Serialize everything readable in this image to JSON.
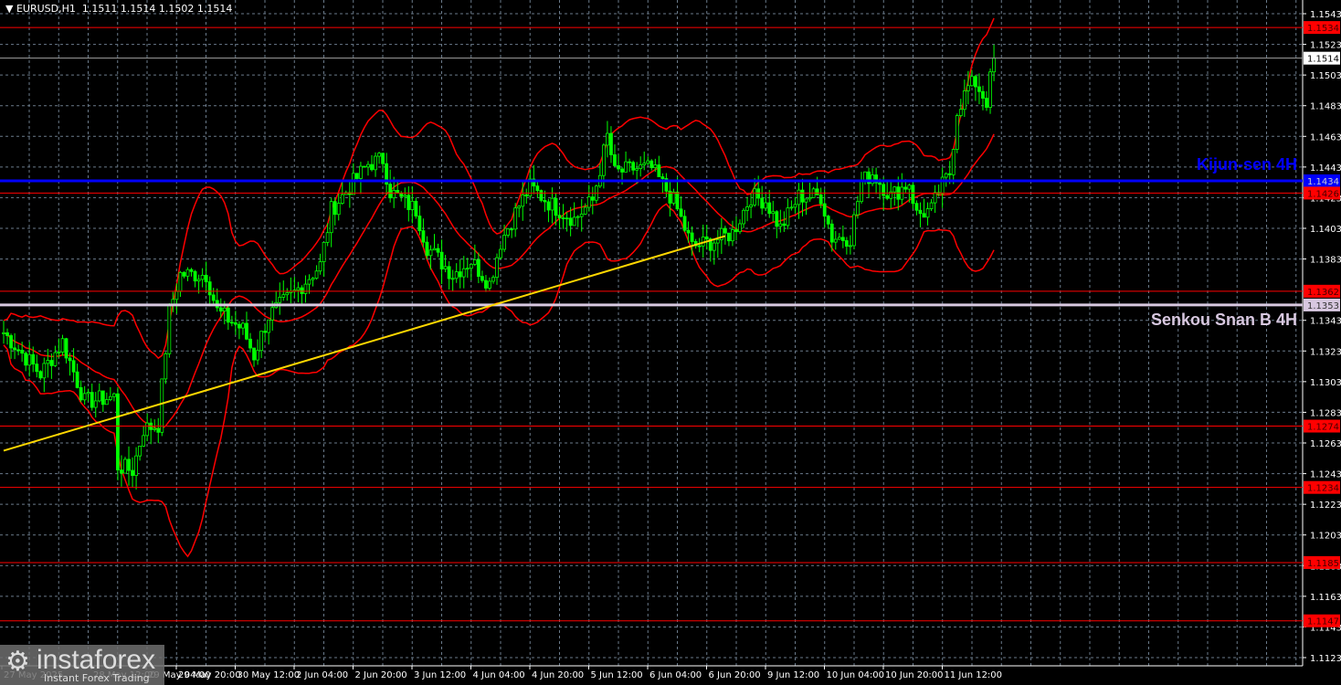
{
  "header": {
    "symbol": "EURUSD,H1",
    "ohlc": "1.1511 1.1514 1.1502 1.1514"
  },
  "logo": {
    "name": "instaforex",
    "tagline": "Instant Forex Trading"
  },
  "chart_data": {
    "type": "candlestick",
    "title": "EURUSD,H1",
    "ylim": [
      1.1113,
      1.1553
    ],
    "y_ticks": [
      "1.1543",
      "1.1523",
      "1.1503",
      "1.1483",
      "1.1463",
      "1.1443",
      "1.1423",
      "1.1403",
      "1.1383",
      "1.1343",
      "1.1323",
      "1.1303",
      "1.1283",
      "1.1263",
      "1.1243",
      "1.1223",
      "1.1203",
      "1.1183",
      "1.1163",
      "1.1143",
      "1.1123"
    ],
    "x_ticks": [
      "27 May 2025",
      "28 May 12:00",
      "29 May 04:00",
      "29 May 20:00",
      "30 May 12:00",
      "2 Jun 04:00",
      "2 Jun 20:00",
      "3 Jun 12:00",
      "4 Jun 04:00",
      "4 Jun 20:00",
      "5 Jun 12:00",
      "6 Jun 04:00",
      "6 Jun 20:00",
      "9 Jun 12:00",
      "10 Jun 04:00",
      "10 Jun 20:00",
      "11 Jun 12:00"
    ],
    "price_path_bar": [
      0,
      10,
      16,
      22,
      30,
      31,
      35,
      38,
      42,
      45,
      48,
      55,
      58,
      65,
      68,
      72,
      79,
      86,
      89,
      94,
      99,
      103,
      105,
      112,
      115,
      122,
      127,
      132,
      135,
      140,
      143,
      149,
      155,
      160,
      164,
      166,
      171,
      176,
      182,
      187,
      192,
      198,
      203,
      207,
      211,
      216,
      222,
      225,
      230,
      233,
      236,
      241,
      246,
      248,
      252,
      254,
      257,
      259,
      262,
      264,
      267,
      269
    ],
    "price_path_close": [
      1.1335,
      1.1308,
      1.1329,
      1.129,
      1.1293,
      1.1248,
      1.1245,
      1.1272,
      1.1275,
      1.1349,
      1.1373,
      1.1373,
      1.1349,
      1.1337,
      1.132,
      1.1346,
      1.1361,
      1.1379,
      1.1415,
      1.143,
      1.1445,
      1.1448,
      1.1427,
      1.1415,
      1.1391,
      1.1373,
      1.1382,
      1.1367,
      1.1394,
      1.1418,
      1.143,
      1.1418,
      1.1409,
      1.1421,
      1.1463,
      1.1439,
      1.1442,
      1.1442,
      1.1421,
      1.1391,
      1.1394,
      1.14,
      1.1424,
      1.1421,
      1.1403,
      1.1424,
      1.1424,
      1.1397,
      1.1397,
      1.1433,
      1.1439,
      1.1424,
      1.1433,
      1.1412,
      1.1415,
      1.1427,
      1.1439,
      1.148,
      1.1495,
      1.1498,
      1.1486,
      1.1514
    ],
    "trendline": {
      "from_bar": 0,
      "from_price": 1.1258,
      "to_bar": 196,
      "to_price": 1.1398,
      "color": "#ffd700"
    },
    "levels": [
      {
        "price": 1.1534,
        "label": "1.1534",
        "color": "#ff0000",
        "style": "line"
      },
      {
        "price": 1.1514,
        "label": "1.1514",
        "color": "#a0a0a0",
        "style": "current"
      },
      {
        "price": 1.1434,
        "label": "1.1434",
        "color": "#0000ff",
        "style": "thick",
        "name": "Kijun-sen 4H"
      },
      {
        "price": 1.1426,
        "label": "1.1426",
        "color": "#ff0000",
        "style": "line"
      },
      {
        "price": 1.1362,
        "label": "1.1362",
        "color": "#ff0000",
        "style": "line"
      },
      {
        "price": 1.1353,
        "label": "1.1353",
        "color": "#d8c8e0",
        "style": "thick",
        "name": "Senkou Snan B 4H"
      },
      {
        "price": 1.1274,
        "label": "1.1274",
        "color": "#ff0000",
        "style": "line"
      },
      {
        "price": 1.1234,
        "label": "1.1234",
        "color": "#ff0000",
        "style": "line"
      },
      {
        "price": 1.1185,
        "label": "1.1185",
        "color": "#ff0000",
        "style": "line"
      },
      {
        "price": 1.1147,
        "label": "1.1147",
        "color": "#ff0000",
        "style": "line"
      }
    ],
    "colors": {
      "bull": "#00ff00",
      "bear": "#00ff00",
      "bands": "#ff0000",
      "grid": "#6a7a8a"
    }
  }
}
